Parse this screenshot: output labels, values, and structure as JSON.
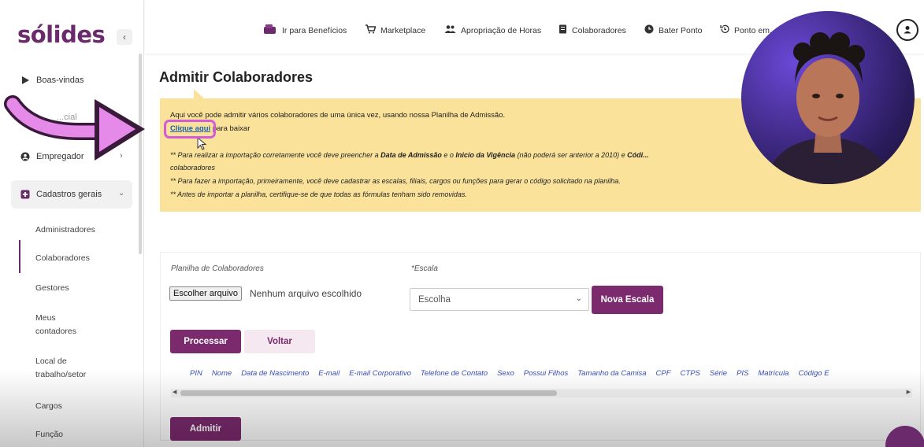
{
  "brand": {
    "logo": "sólides",
    "collapse_icon": "‹"
  },
  "sidebar": {
    "items": [
      {
        "label": "Boas-vindas",
        "icon": "play-icon"
      },
      {
        "label": "Empregador",
        "icon": "user-circle-icon"
      },
      {
        "label": "Cadastros gerais",
        "icon": "folder-icon"
      }
    ],
    "partial_item": "...cial",
    "subitems": [
      "Administradores",
      "Colaboradores",
      "Gestores",
      "Meus contadores",
      "Local de trabalho/setor",
      "Cargos",
      "Função"
    ]
  },
  "topnav": {
    "items": [
      {
        "label": "Ir para Benefícios",
        "icon": "wallet-icon"
      },
      {
        "label": "Marketplace",
        "icon": "cart-icon"
      },
      {
        "label": "Apropriação de Horas",
        "icon": "people-icon"
      },
      {
        "label": "Colaboradores",
        "icon": "document-icon"
      },
      {
        "label": "Bater Ponto",
        "icon": "clock-icon"
      },
      {
        "label": "Ponto em...",
        "icon": "history-icon"
      }
    ]
  },
  "main": {
    "title": "Admitir Colaboradores",
    "info": {
      "line1": "Aqui você pode admitir vários colaboradores de uma única vez, usando nossa Planilha de Admissão.",
      "link": "Clique aqui",
      "link_suffix": " para baixar",
      "note1_a": "** Para realizar a importação corretamente você deve preencher a ",
      "note1_b": "Data de Admissão",
      "note1_c": " e o ",
      "note1_d": "Inicio da Vigência",
      "note1_e": " (não poderá ser anterior a 2010) e ",
      "note1_f": "Códi...",
      "note1_cont": "colaboradores",
      "note2": "** Para fazer a importação, primeiramente, você deve cadastrar as escalas, filiais, cargos ou funções para gerar o código solicitado na planilha.",
      "note3": "** Antes de importar a planilha, certifique-se de que todas as fórmulas tenham sido removidas."
    },
    "form": {
      "file_label": "Planilha de Colaboradores",
      "file_button": "Escolher arquivo",
      "file_status": "Nenhum arquivo escolhido",
      "scale_label": "*Escala",
      "scale_value": "Escolha",
      "new_scale": "Nova Escala",
      "process": "Processar",
      "back": "Voltar",
      "admit": "Admitir",
      "columns": [
        "PIN",
        "Nome",
        "Data de Nascimento",
        "E-mail",
        "E-mail Corporativo",
        "Telefone de Contato",
        "Sexo",
        "Possui Filhos",
        "Tamanho da Camisa",
        "CPF",
        "CTPS",
        "Série",
        "PIS",
        "Matrícula",
        "Código E"
      ]
    }
  },
  "colors": {
    "brand": "#6b2a6b",
    "info_bg": "#fbe29a",
    "link": "#1b5ea8",
    "highlight": "#d45ad8"
  }
}
